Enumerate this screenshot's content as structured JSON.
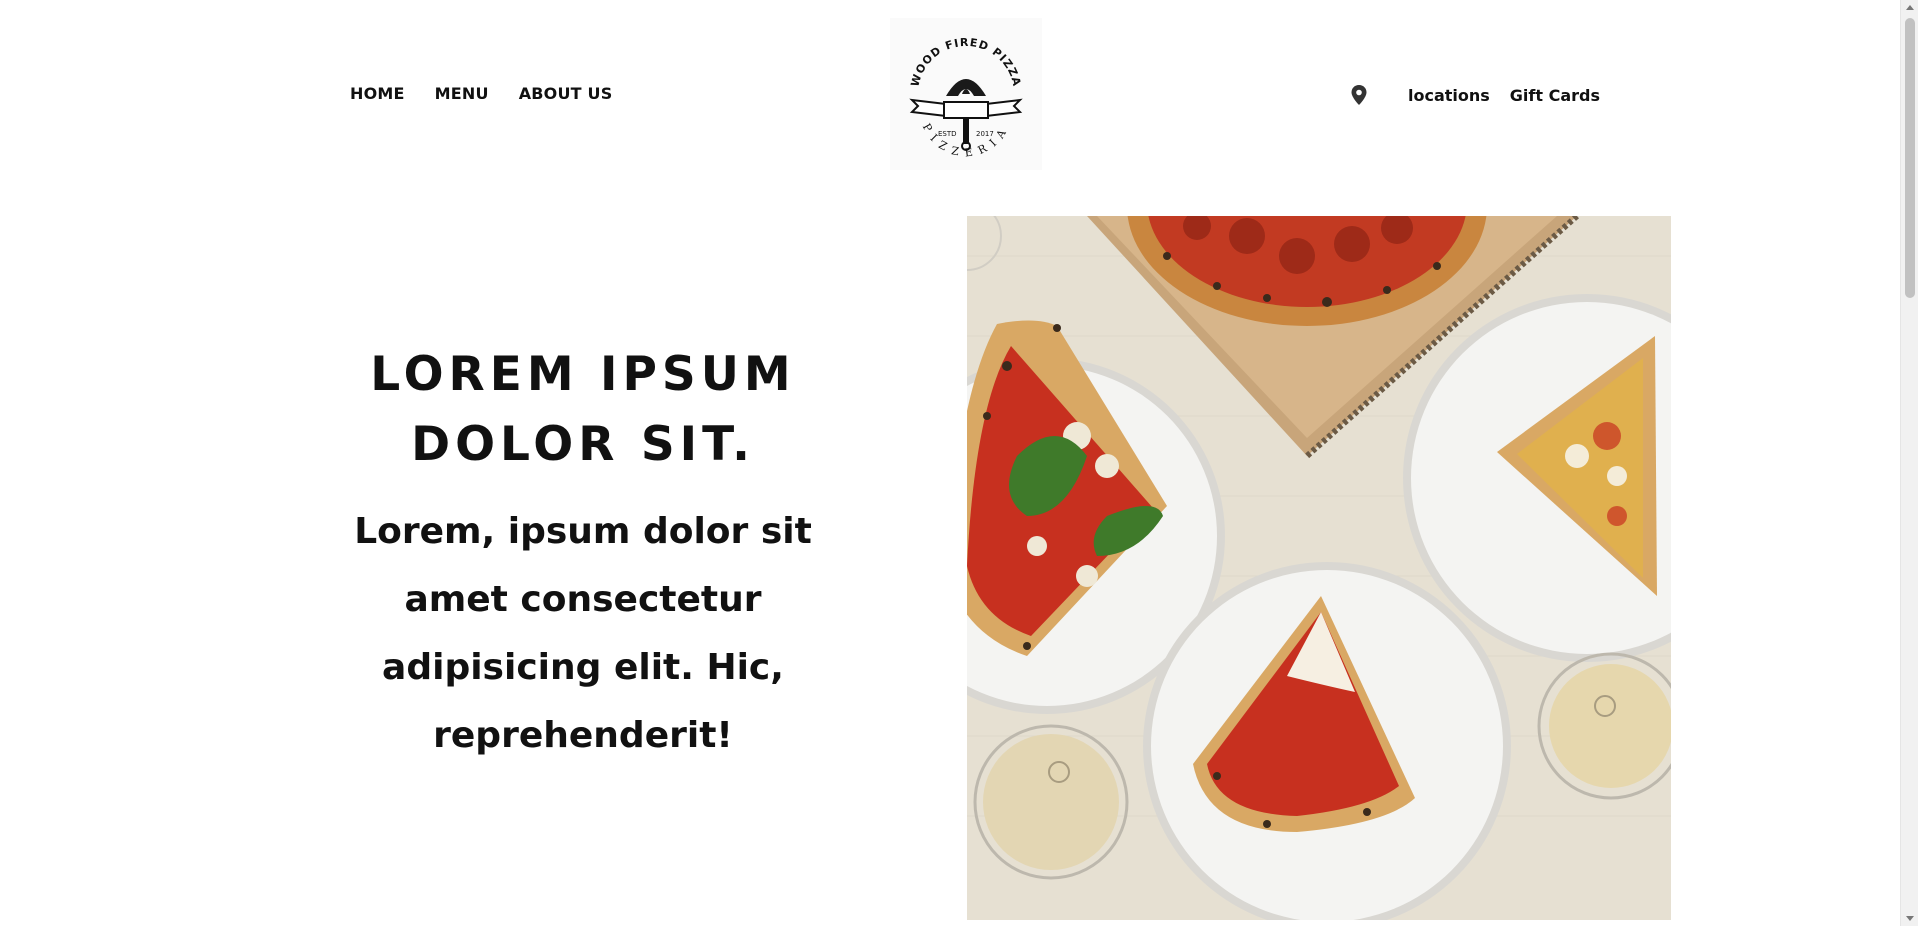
{
  "nav": {
    "left": [
      {
        "label": "HOME"
      },
      {
        "label": "MENU"
      },
      {
        "label": "ABOUT US"
      }
    ],
    "right": {
      "locations_label": "locations",
      "gift_cards_label": "Gift Cards",
      "location_icon": "map-pin-icon"
    }
  },
  "logo": {
    "top_text": "WOOD FIRED PIZZA",
    "bottom_text": "PIZZERIA",
    "left_mark": "ESTD",
    "right_mark": "2017"
  },
  "hero": {
    "title_line1": "LOREM IPSUM",
    "title_line2": "DOLOR SIT.",
    "body": "Lorem, ipsum dolor sit amet consectetur adipisicing elit. Hic, reprehenderit!"
  },
  "colors": {
    "text": "#111111",
    "background": "#ffffff",
    "tablecloth": "#e6e0d2",
    "plate": "#f4f4f2",
    "sauce": "#c7301f",
    "crust": "#d9a864",
    "basil": "#3f7a2a"
  }
}
